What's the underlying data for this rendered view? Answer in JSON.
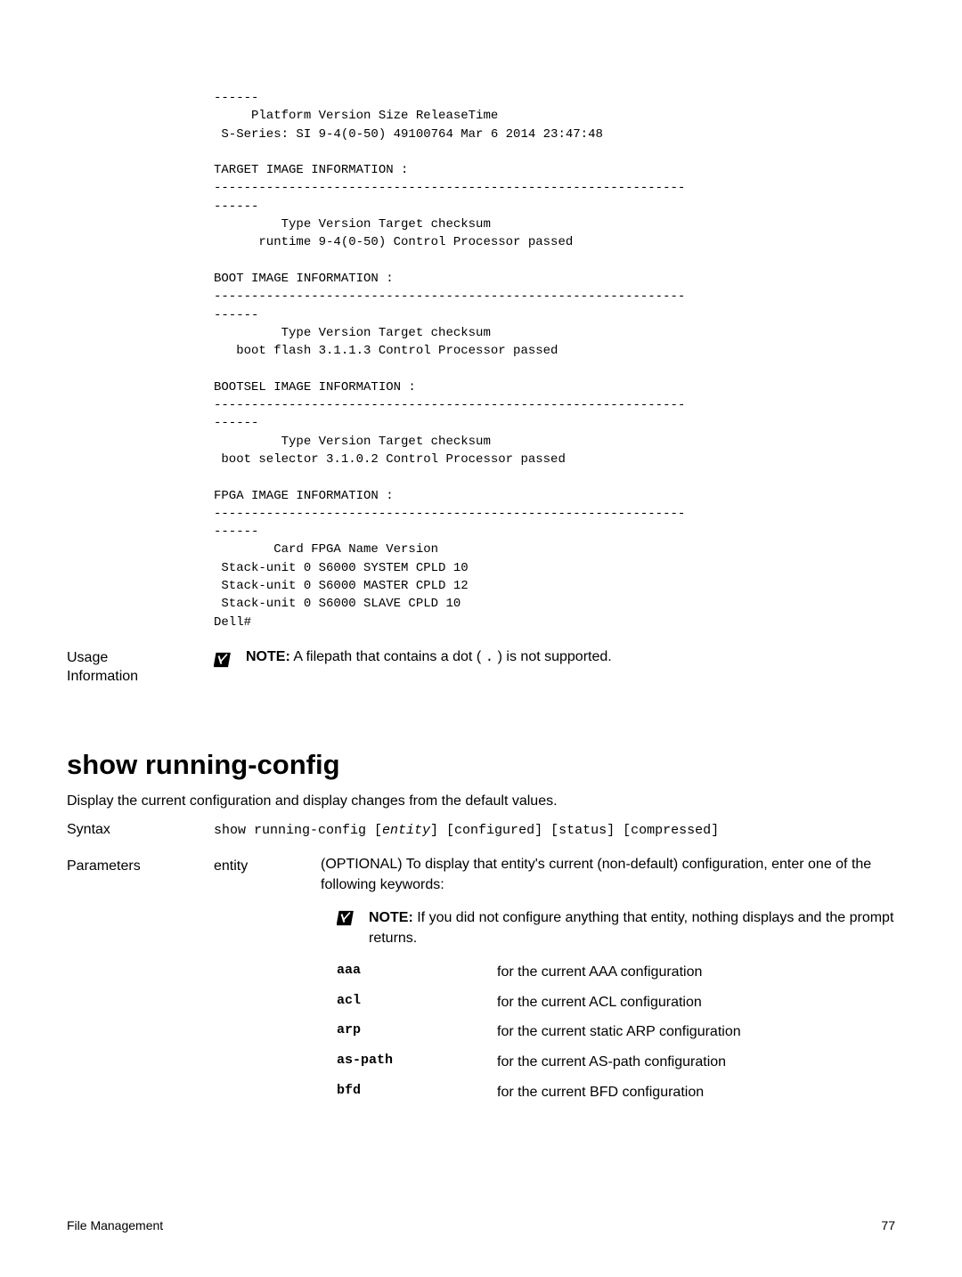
{
  "code_output": "------\n     Platform Version Size ReleaseTime\n S-Series: SI 9-4(0-50) 49100764 Mar 6 2014 23:47:48\n\nTARGET IMAGE INFORMATION :\n---------------------------------------------------------------\n------\n         Type Version Target checksum\n      runtime 9-4(0-50) Control Processor passed\n\nBOOT IMAGE INFORMATION :\n---------------------------------------------------------------\n------\n         Type Version Target checksum\n   boot flash 3.1.1.3 Control Processor passed\n\nBOOTSEL IMAGE INFORMATION :\n---------------------------------------------------------------\n------\n         Type Version Target checksum\n boot selector 3.1.0.2 Control Processor passed\n\nFPGA IMAGE INFORMATION :\n---------------------------------------------------------------\n------\n        Card FPGA Name Version\n Stack-unit 0 S6000 SYSTEM CPLD 10\n Stack-unit 0 S6000 MASTER CPLD 12\n Stack-unit 0 S6000 SLAVE CPLD 10\nDell#",
  "usage": {
    "label_line1": "Usage",
    "label_line2": "Information",
    "note_prefix": "NOTE:",
    "note_text_a": " A filepath that contains a dot ( ",
    "dot": ".",
    "note_text_b": " ) is not supported."
  },
  "heading": "show running-config",
  "description": "Display the current configuration and display changes from the default values.",
  "syntax": {
    "label": "Syntax",
    "cmd": "show running-config [",
    "entity": "entity",
    "rest": "] [configured] [status] [compressed]"
  },
  "parameters": {
    "label": "Parameters",
    "entity_label": "entity",
    "desc": "(OPTIONAL) To display that entity's current (non-default) configuration, enter one of the following keywords:",
    "note_prefix": "NOTE:",
    "note_text": " If you did not configure anything that entity, nothing displays and the prompt returns.",
    "keywords": [
      {
        "name": "aaa",
        "desc": "for the current AAA configuration"
      },
      {
        "name": "acl",
        "desc": "for the current ACL configuration"
      },
      {
        "name": "arp",
        "desc": "for the current static ARP configuration"
      },
      {
        "name": "as-path",
        "desc": "for the current AS-path configuration"
      },
      {
        "name": "bfd",
        "desc": "for the current BFD configuration"
      }
    ]
  },
  "footer": {
    "left": "File Management",
    "right": "77"
  }
}
